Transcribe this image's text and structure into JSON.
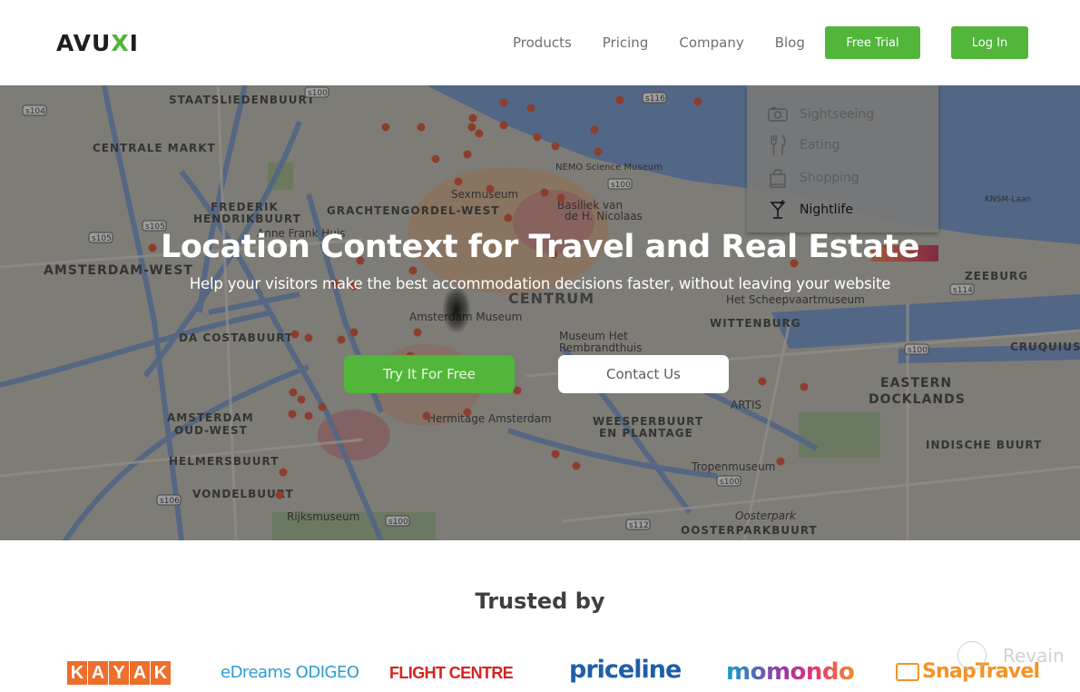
{
  "header": {
    "logo": {
      "prefix": "AVU",
      "accent": "X",
      "suffix": "I"
    },
    "nav": [
      "Products",
      "Pricing",
      "Company",
      "Blog"
    ],
    "free_trial_label": "Free Trial",
    "login_label": "Log In"
  },
  "hero": {
    "title": "Location Context for Travel and Real Estate",
    "subtitle": "Help your visitors make the best accommodation decisions faster, without leaving your website",
    "try_label": "Try It For Free",
    "contact_label": "Contact Us",
    "poi_menu": [
      {
        "label": "Sightseeing",
        "icon": "camera-icon",
        "active": false
      },
      {
        "label": "Eating",
        "icon": "fork-knife-icon",
        "active": false
      },
      {
        "label": "Shopping",
        "icon": "shopping-bag-icon",
        "active": false
      },
      {
        "label": "Nightlife",
        "icon": "cocktail-icon",
        "active": true
      }
    ],
    "map_labels": [
      "STAATSLIEDENBUURT",
      "CENTRALE MARKT",
      "FREDERIK HENDRIKBUURT",
      "AMSTERDAM-WEST",
      "DA COSTABUURT",
      "AMSTERDAM OUD-WEST",
      "HELMERSBUURT",
      "VONDELBUURT",
      "Sexmuseum",
      "Basiliek van de H. Nicolaas",
      "NEMO Science Museum",
      "Anne Frank Huis",
      "CENTRUM",
      "Het Scheepvaartmuseum",
      "WITTENBURG",
      "ZEEBURG",
      "CRUQUIUS",
      "EASTERN DOCKLANDS",
      "INDISCHE BUURT",
      "ARTIS",
      "Museum Het Rembrandthuis",
      "Hermitage Amsterdam",
      "WEESPERBUURT EN PLANTAGE",
      "Tropenmuseum",
      "Oosterpark",
      "OOSTERPARKBUURT",
      "Rijksmuseum",
      "GRACHTENGORDEL-WEST",
      "KNSM-Laan"
    ],
    "road_badges": [
      "s104",
      "s100",
      "s105",
      "s116",
      "s114",
      "s106",
      "s112"
    ]
  },
  "trusted": {
    "title": "Trusted by",
    "logos": {
      "kayak": [
        "K",
        "A",
        "Y",
        "A",
        "K"
      ],
      "edreams": "eDreams ODIGEO",
      "flight_centre": "FLIGHT CENTRE",
      "priceline": "priceline",
      "momondo": "momondo",
      "snaptravel": "SnapTravel"
    }
  },
  "watermark": "Revain",
  "colors": {
    "brand_green": "#51b63a",
    "map_dot": "#c8452e"
  }
}
